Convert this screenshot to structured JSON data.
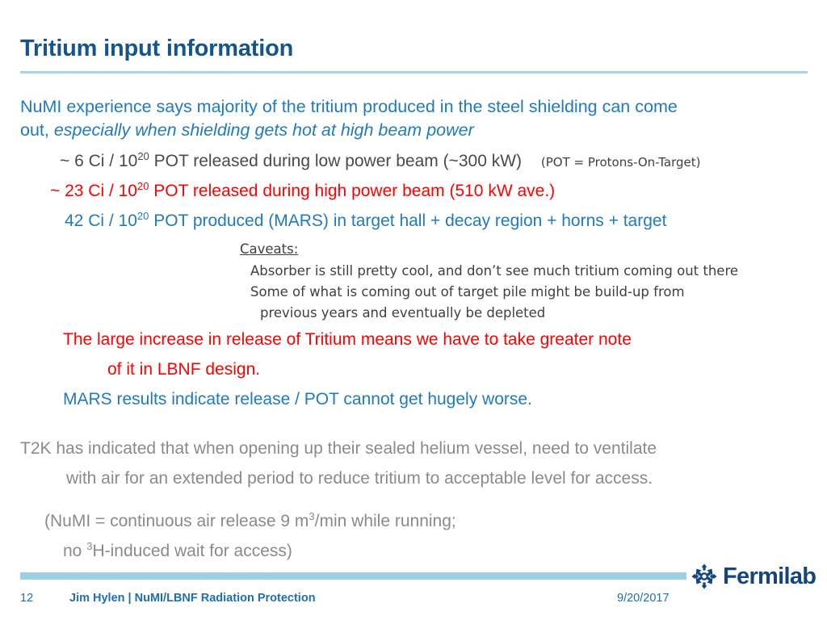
{
  "slide": {
    "title": "Tritium input information",
    "accent_blue": "#1F7AC0",
    "title_blue": "#15558D",
    "red": "#FF0000",
    "gray": "#8A8A8A",
    "rule_blue": "#A8D5E8",
    "bar_blue": "#9CCFE4"
  },
  "body": {
    "intro_line1": "NuMI experience says majority of the tritium produced in the steel shielding can come",
    "intro_line2_prefix": "out, ",
    "intro_line2_italic": "especially when shielding gets hot at high beam power",
    "bullet_low_pre": "~ 6 Ci / 10",
    "bullet_low_sup": "20",
    "bullet_low_post": " POT released during low power beam (~300 kW)",
    "bullet_low_note": "(POT = Protons-On-Target)",
    "bullet_high_pre": "~ 23 Ci / 10",
    "bullet_high_sup": "20",
    "bullet_high_post": " POT released during high power beam (510 kW ave.)",
    "bullet_mars_pre": "42 Ci / 10",
    "bullet_mars_sup": "20",
    "bullet_mars_post": " POT produced (MARS) in target hall + decay region + horns + target",
    "caveats_heading": "Caveats:",
    "caveat_1": "Absorber is still pretty cool, and don’t see much tritium coming out there",
    "caveat_2": "Some of what is coming out of target pile might be build-up from",
    "caveat_3": "previous years and eventually be depleted",
    "emphasis_line1": "The large increase in release of Tritium means we have to take greater note",
    "emphasis_line2": "of it in LBNF design.",
    "mars_result": "MARS results indicate release / POT cannot get hugely worse.",
    "t2k_line1": "T2K has indicated that when opening up their sealed helium vessel, need to ventilate",
    "t2k_line2": "with air for an extended period to reduce tritium to acceptable level for access.",
    "numi_line1_pre": "(NuMI = continuous air release 9 m",
    "numi_line1_sup": "3",
    "numi_line1_post": "/min while running;",
    "numi_line2_pre": "no ",
    "numi_line2_sup": "3",
    "numi_line2_post": "H-induced wait for access)"
  },
  "footer": {
    "slide_number": "12",
    "author_line": "Jim Hylen  |  NuMI/LBNF Radiation Protection",
    "date": "9/20/2017",
    "logo_word": "Fermilab"
  }
}
